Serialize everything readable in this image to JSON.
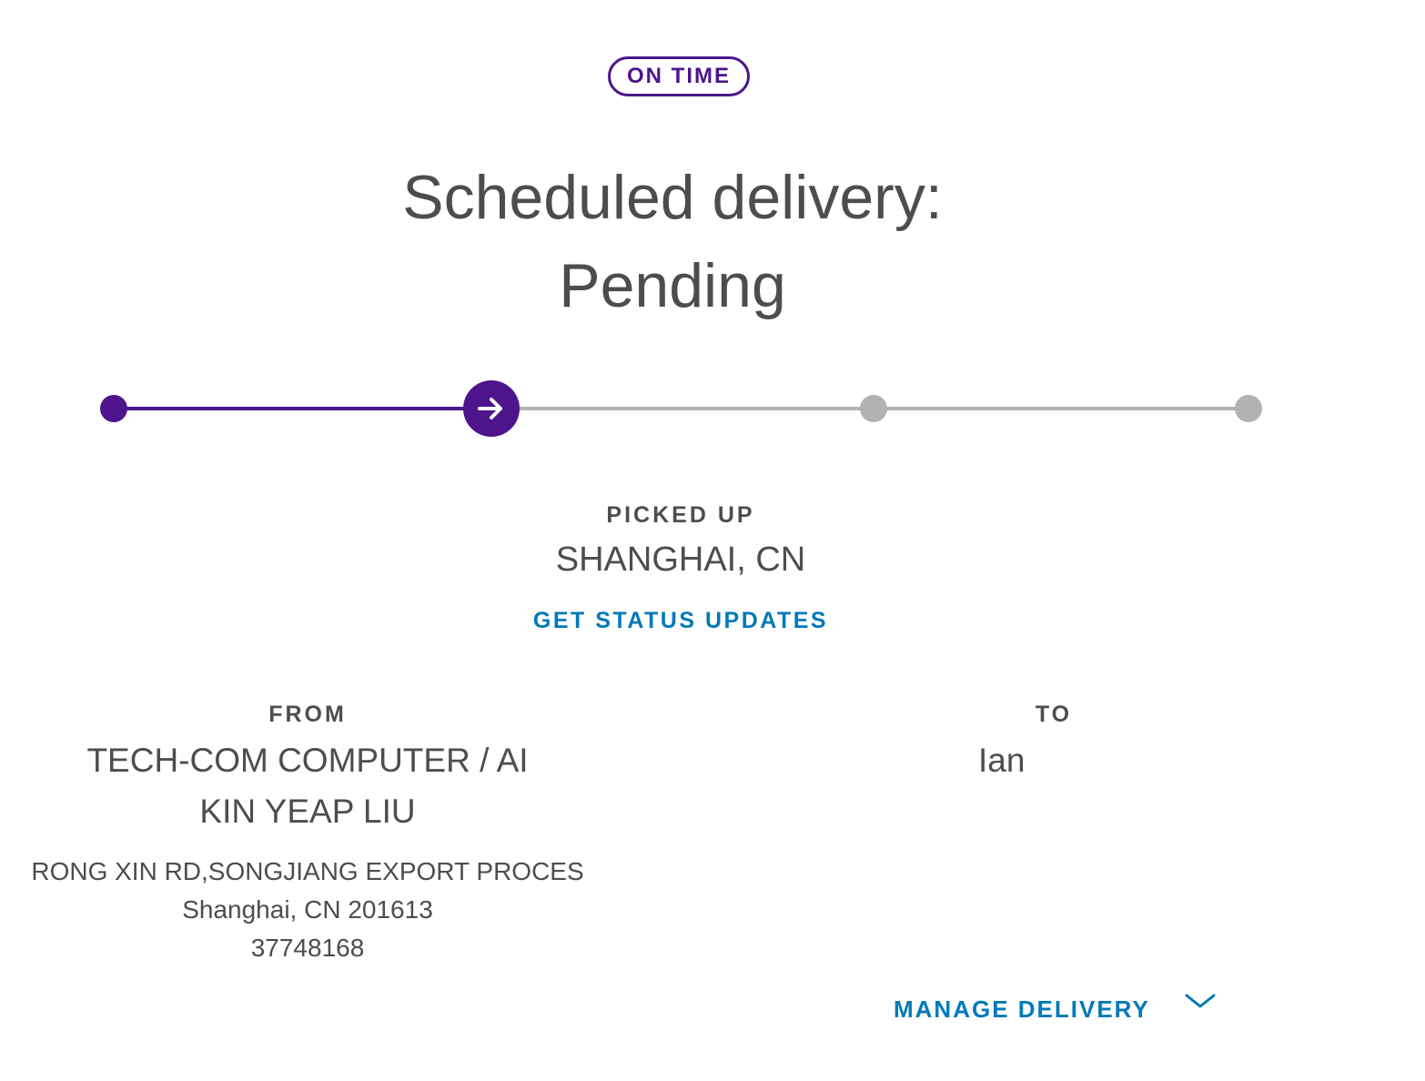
{
  "status_badge": {
    "label": "ON TIME"
  },
  "headline": {
    "line1": "Scheduled delivery:",
    "line2": "Pending"
  },
  "progress": {
    "steps": 4,
    "current_step": 2,
    "colors": {
      "complete": "#4d148c",
      "incomplete": "#b2b2b2"
    },
    "current_icon": "arrow-right-icon"
  },
  "milestone": {
    "label": "PICKED UP",
    "location": "SHANGHAI, CN"
  },
  "status_updates_link": "GET STATUS UPDATES",
  "from": {
    "heading": "FROM",
    "name_line1": "TECH-COM COMPUTER / AI",
    "name_line2": "KIN YEAP LIU",
    "address_line1": "RONG XIN RD,SONGJIANG EXPORT PROCES",
    "address_line2": "Shanghai, CN 201613",
    "phone": "37748168"
  },
  "to": {
    "heading": "TO",
    "name": "Ian"
  },
  "manage_delivery": {
    "label": "MANAGE DELIVERY",
    "icon": "chevron-down-icon"
  },
  "colors": {
    "brand_purple": "#4d148c",
    "link_blue": "#007ab7",
    "text": "#4d4d4d"
  }
}
